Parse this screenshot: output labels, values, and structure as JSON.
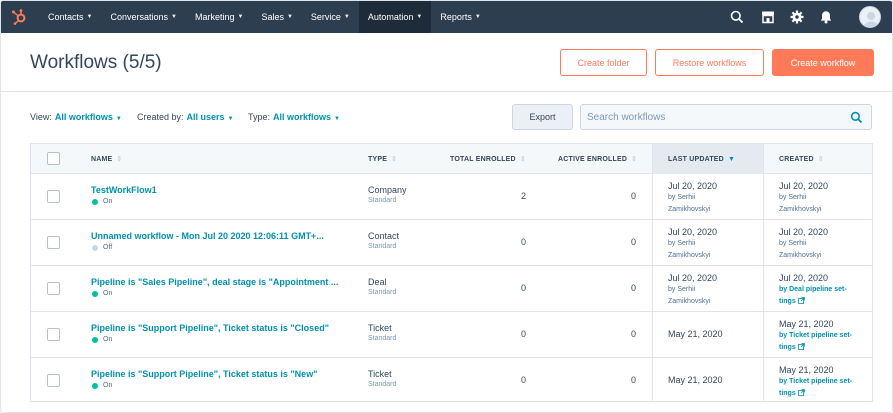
{
  "nav": {
    "items": [
      {
        "label": "Contacts",
        "caret": true,
        "active": false
      },
      {
        "label": "Conversations",
        "caret": true,
        "active": false
      },
      {
        "label": "Marketing",
        "caret": true,
        "active": false
      },
      {
        "label": "Sales",
        "caret": true,
        "active": false
      },
      {
        "label": "Service",
        "caret": true,
        "active": false
      },
      {
        "label": "Automation",
        "caret": true,
        "active": true
      },
      {
        "label": "Reports",
        "caret": true,
        "active": false
      }
    ],
    "icons": [
      "search-icon",
      "marketplace-icon",
      "settings-icon",
      "notifications-icon"
    ]
  },
  "page": {
    "title": "Workflows (5/5)",
    "create_folder": "Create folder",
    "restore_workflows": "Restore workflows",
    "create_workflow": "Create workflow"
  },
  "filters": {
    "view_label": "View:",
    "view_value": "All workflows",
    "created_by_label": "Created by:",
    "created_by_value": "All users",
    "type_label": "Type:",
    "type_value": "All workflows",
    "export": "Export",
    "search_placeholder": "Search workflows"
  },
  "table": {
    "headers": {
      "name": "NAME",
      "type": "TYPE",
      "total_enrolled": "TOTAL ENROLLED",
      "active_enrolled": "ACTIVE ENROLLED",
      "last_updated": "LAST UPDATED",
      "created": "CREATED"
    },
    "rows": [
      {
        "name": "TestWorkFlow1",
        "status": "On",
        "type": "Company",
        "subtype": "Standard",
        "total": "2",
        "active": "0",
        "updated_date": "Jul 20, 2020",
        "updated_by": "by Serhii",
        "updated_by2": "Zamikhovskyi",
        "created_date": "Jul 20, 2020",
        "created_by": "by Serhii",
        "created_by2": "Zamikhovskyi"
      },
      {
        "name": "Unnamed workflow - Mon Jul 20 2020 12:06:11 GMT+...",
        "status": "Off",
        "type": "Contact",
        "subtype": "Standard",
        "total": "0",
        "active": "0",
        "updated_date": "Jul 20, 2020",
        "updated_by": "by Serhii",
        "updated_by2": "Zamikhovskyi",
        "created_date": "Jul 20, 2020",
        "created_by": "by Serhii",
        "created_by2": "Zamikhovskyi"
      },
      {
        "name": "Pipeline is \"Sales Pipeline\", deal stage is \"Appointment ...",
        "status": "On",
        "type": "Deal",
        "subtype": "Standard",
        "total": "0",
        "active": "0",
        "updated_date": "Jul 20, 2020",
        "updated_by": "by Serhii",
        "updated_by2": "Zamikhovskyi",
        "created_date": "Jul 20, 2020",
        "created_link": "by Deal pipeline set-",
        "created_link2": "tings"
      },
      {
        "name": "Pipeline is \"Support Pipeline\", Ticket status is \"Closed\"",
        "status": "On",
        "type": "Ticket",
        "subtype": "Standard",
        "total": "0",
        "active": "0",
        "updated_date": "May 21, 2020",
        "created_date": "May 21, 2020",
        "created_link": "by Ticket pipeline set-",
        "created_link2": "tings"
      },
      {
        "name": "Pipeline is \"Support Pipeline\", Ticket status is \"New\"",
        "status": "On",
        "type": "Ticket",
        "subtype": "Standard",
        "total": "0",
        "active": "0",
        "updated_date": "May 21, 2020",
        "created_date": "May 21, 2020",
        "created_link": "by Ticket pipeline set-",
        "created_link2": "tings"
      }
    ]
  },
  "colors": {
    "nav_bg": "#2d3e50",
    "accent": "#ff7a59",
    "link": "#0091ae",
    "status_on": "#00bda5",
    "status_off": "#cbd6e2"
  }
}
